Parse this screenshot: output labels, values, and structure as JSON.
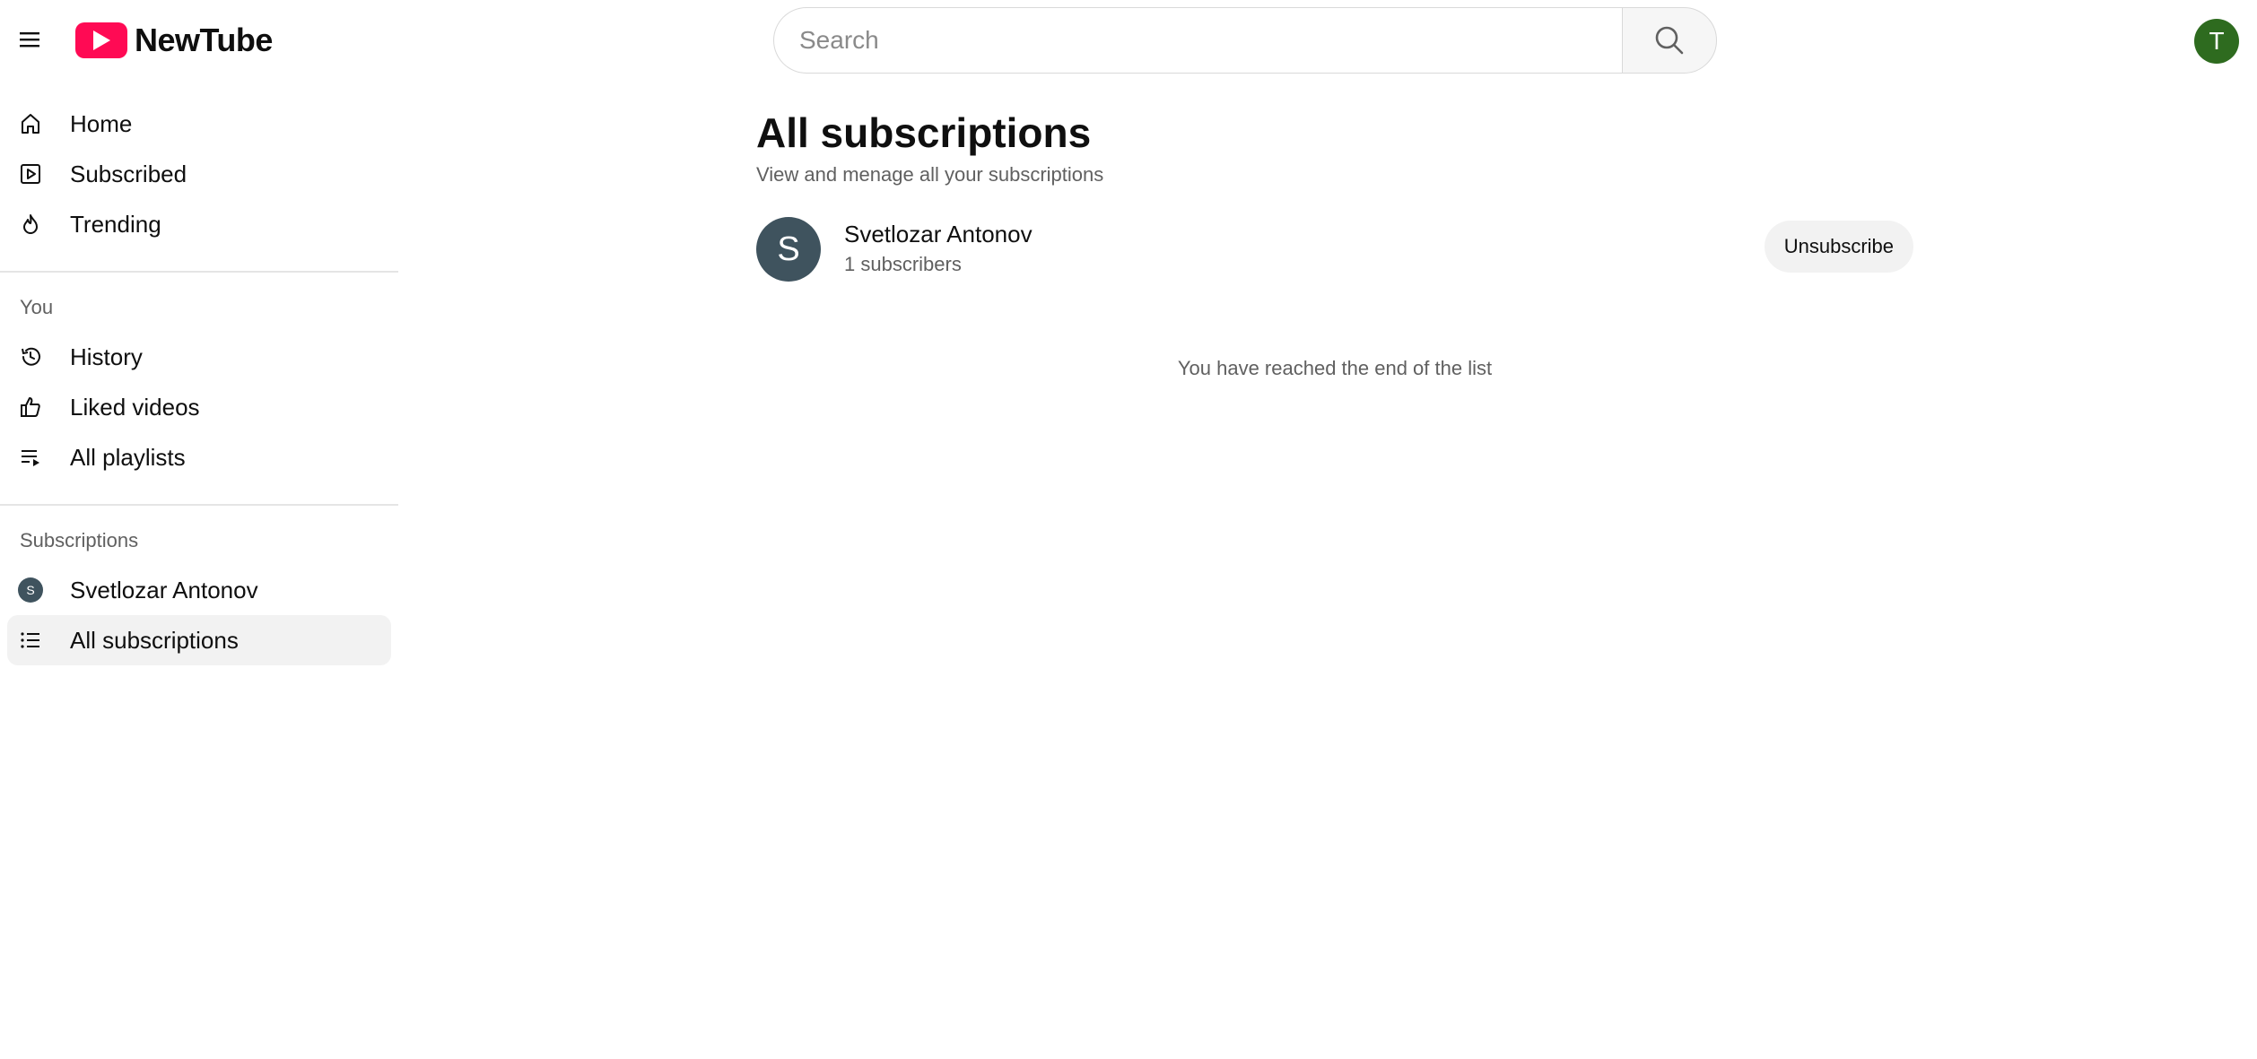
{
  "header": {
    "logo_text": "NewTube",
    "search_placeholder": "Search",
    "avatar_letter": "T",
    "brand_color": "#ff0a54",
    "avatar_color": "#2e6b1f"
  },
  "sidebar": {
    "main_items": [
      {
        "label": "Home",
        "icon": "home-icon"
      },
      {
        "label": "Subscribed",
        "icon": "play-square-icon"
      },
      {
        "label": "Trending",
        "icon": "flame-icon"
      }
    ],
    "you_title": "You",
    "you_items": [
      {
        "label": "History",
        "icon": "history-icon"
      },
      {
        "label": "Liked videos",
        "icon": "thumbs-up-icon"
      },
      {
        "label": "All playlists",
        "icon": "playlist-icon"
      }
    ],
    "subs_title": "Subscriptions",
    "subs_items": [
      {
        "label": "Svetlozar Antonov",
        "avatar_letter": "S"
      },
      {
        "label": "All subscriptions",
        "icon": "list-icon",
        "active": true
      }
    ]
  },
  "main": {
    "title": "All subscriptions",
    "subtitle": "View and menage all your subscriptions",
    "subscriptions": [
      {
        "avatar_letter": "S",
        "name": "Svetlozar Antonov",
        "count": "1 subscribers",
        "button": "Unsubscribe"
      }
    ],
    "end_text": "You have reached the end of the list"
  }
}
